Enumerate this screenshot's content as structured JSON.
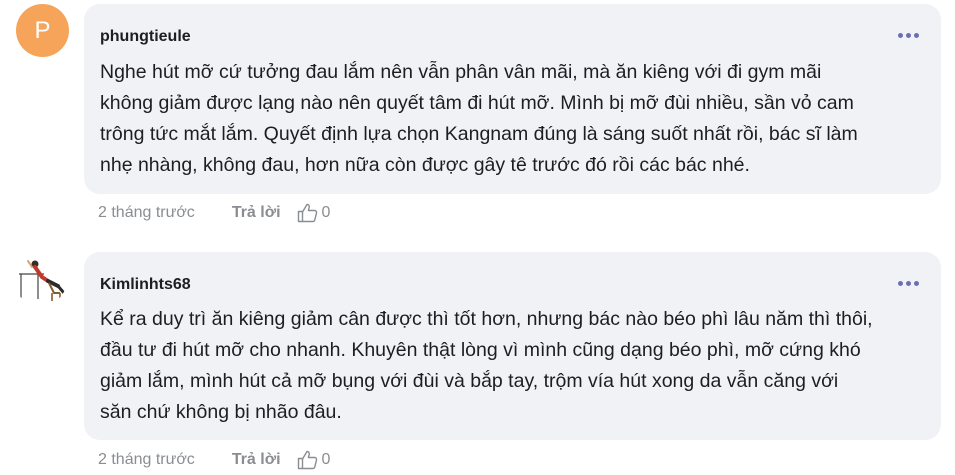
{
  "comments": [
    {
      "avatar_letter": "P",
      "author": "phungtieule",
      "lines": [
        "Nghe hút mỡ cứ tưởng đau lắm nên vẫn phân vân mãi, mà ăn kiêng với đi gym mãi",
        "không giảm được lạng nào nên quyết tâm đi hút mỡ. Mình bị mỡ đùi nhiều, sần vỏ cam",
        "trông tức mắt lắm. Quyết định lựa chọn Kangnam đúng là sáng suốt nhất rồi, bác sĩ làm",
        "nhẹ nhàng, không đau, hơn nữa còn được gây tê trước đó rồi các bác nhé."
      ],
      "time": "2 tháng trước",
      "reply_label": "Trả lời",
      "like_count": "0"
    },
    {
      "author": "Kimlinhts68",
      "lines": [
        "Kể ra duy trì ăn kiêng giảm cân được thì tốt hơn, nhưng bác nào béo phì lâu năm thì thôi,",
        "đầu tư đi hút mỡ cho nhanh. Khuyên thật lòng vì mình cũng dạng béo phì, mỡ cứng khó",
        "giảm lắm, mình hút cả mỡ bụng với đùi và bắp tay, trộm vía hút xong da vẫn căng với",
        "săn chứ không bị nhão đâu."
      ],
      "time": "2 tháng trước",
      "reply_label": "Trả lời",
      "like_count": "0"
    }
  ],
  "colors": {
    "bubble": "#f1f2f5",
    "avatar_letter_bg": "#f5a45a",
    "more_dots": "#6b6fb3",
    "meta_text": "#8a8d91"
  },
  "icons": [
    "more-options-icon",
    "thumbs-up-icon"
  ]
}
